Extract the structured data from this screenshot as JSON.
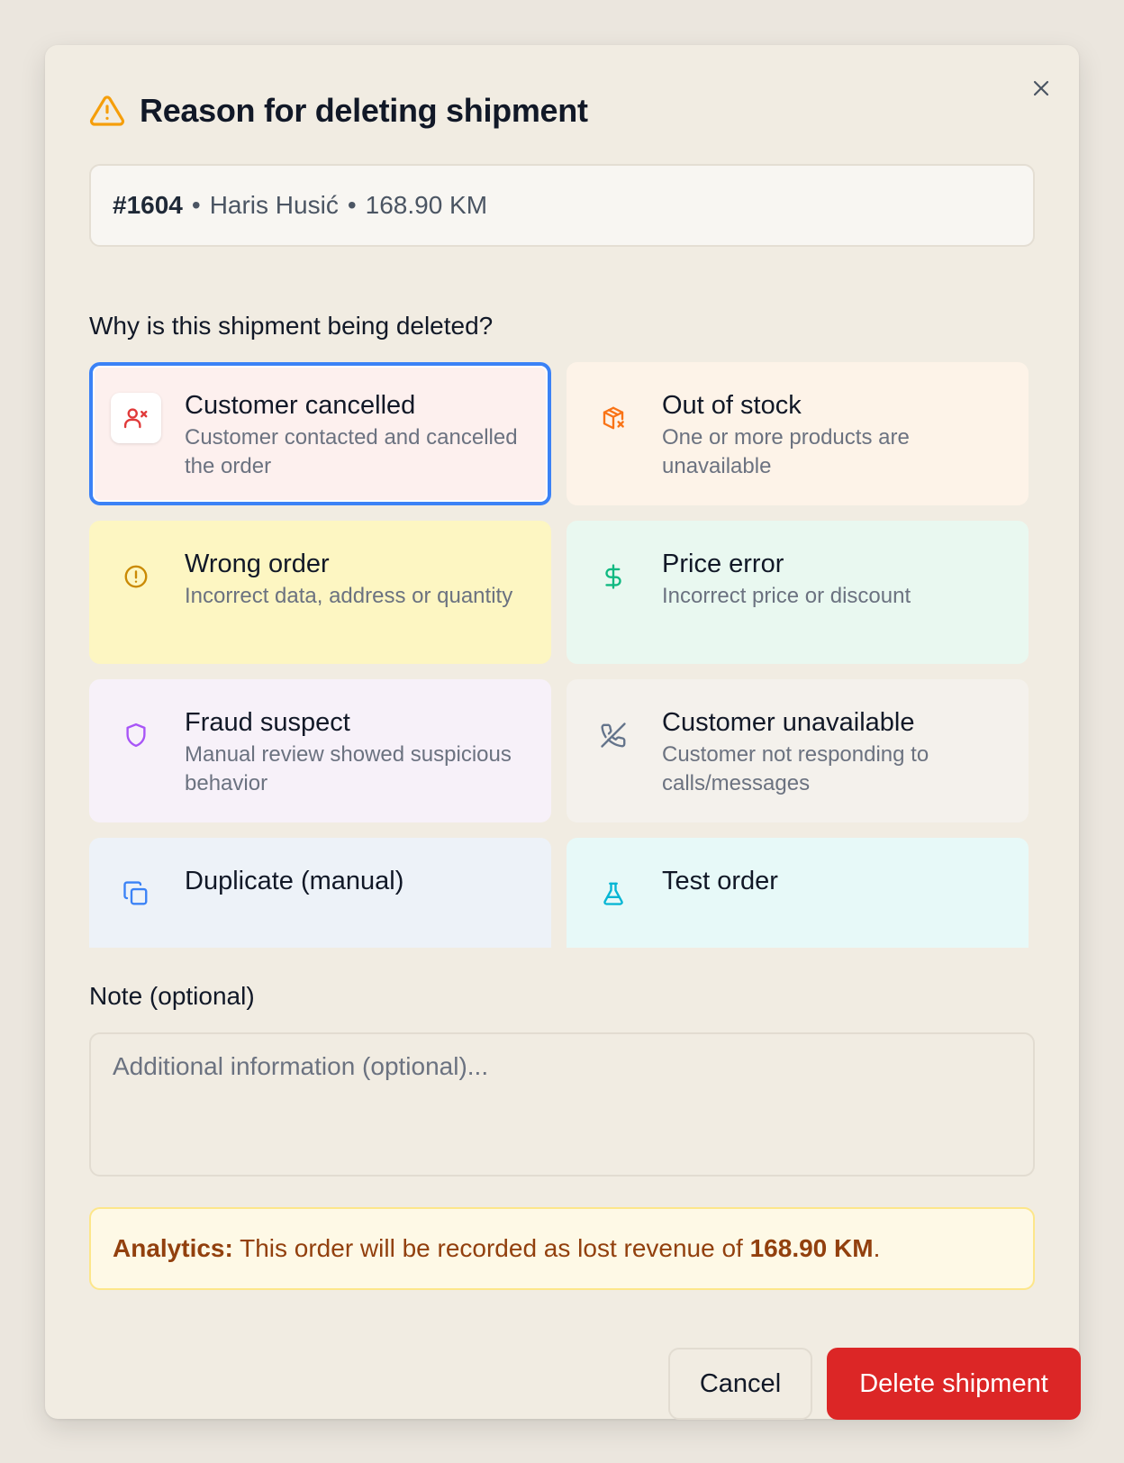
{
  "dialog": {
    "title": "Reason for deleting shipment",
    "summary": {
      "order_number": "#1604",
      "separator": "•",
      "customer": "Haris Husić",
      "amount": "168.90 KM"
    },
    "question": "Why is this shipment being deleted?",
    "reasons": [
      {
        "key": "customer-cancelled",
        "title": "Customer cancelled",
        "description": "Customer contacted and cancelled the order",
        "icon": "user-x-icon",
        "bg": "#fdf0ee",
        "color": "#e03a3a",
        "selected": true
      },
      {
        "key": "out-of-stock",
        "title": "Out of stock",
        "description": "One or more products are unavailable",
        "icon": "package-x-icon",
        "bg": "#fdf3e8",
        "color": "#f97316",
        "selected": false
      },
      {
        "key": "wrong-order",
        "title": "Wrong order",
        "description": "Incorrect data, address or quantity",
        "icon": "alert-circle-icon",
        "bg": "#fdf6c2",
        "color": "#ca8a04",
        "selected": false
      },
      {
        "key": "price-error",
        "title": "Price error",
        "description": "Incorrect price or discount",
        "icon": "dollar-sign-icon",
        "bg": "#e9f8f0",
        "color": "#10b981",
        "selected": false
      },
      {
        "key": "fraud-suspect",
        "title": "Fraud suspect",
        "description": "Manual review showed suspicious behavior",
        "icon": "shield-icon",
        "bg": "#f7f1f9",
        "color": "#a855f7",
        "selected": false
      },
      {
        "key": "customer-unavailable",
        "title": "Customer unavailable",
        "description": "Customer not responding to calls/messages",
        "icon": "phone-off-icon",
        "bg": "#f4f1ec",
        "color": "#64748b",
        "selected": false
      },
      {
        "key": "duplicate-manual",
        "title": "Duplicate (manual)",
        "description": "",
        "icon": "copy-icon",
        "bg": "#edf2f8",
        "color": "#3b82f6",
        "selected": false
      },
      {
        "key": "test-order",
        "title": "Test order",
        "description": "",
        "icon": "flask-icon",
        "bg": "#e7f9f8",
        "color": "#06b6d4",
        "selected": false
      }
    ],
    "note": {
      "label": "Note (optional)",
      "placeholder": "Additional information (optional)...",
      "value": ""
    },
    "analytics": {
      "label": "Analytics:",
      "text": " This order will be recorded as lost revenue of ",
      "amount": "168.90 KM",
      "end": "."
    },
    "buttons": {
      "cancel": "Cancel",
      "delete": "Delete shipment"
    }
  }
}
